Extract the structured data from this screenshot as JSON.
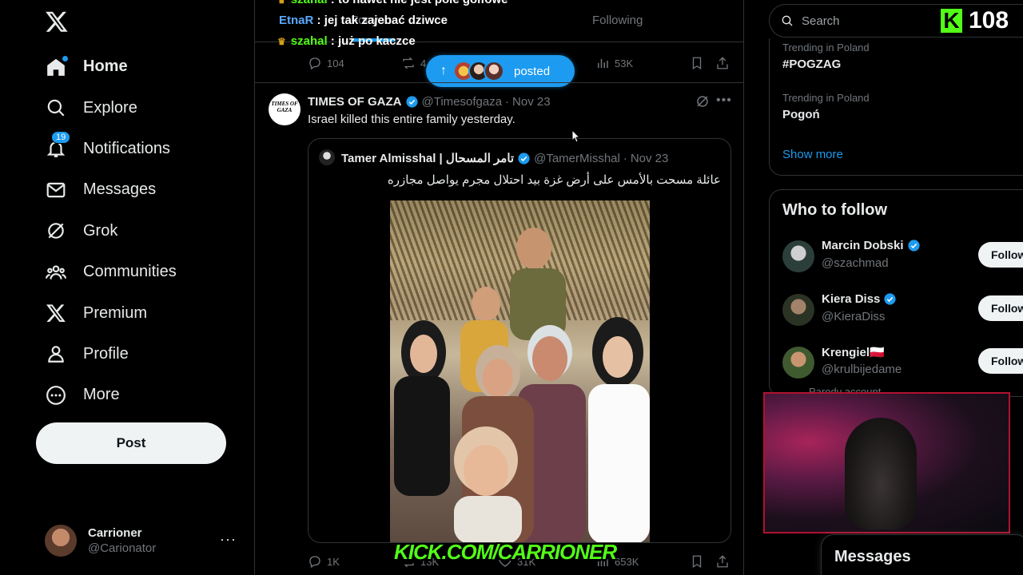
{
  "sidebar": {
    "logo": "X",
    "nav": [
      {
        "label": "Home"
      },
      {
        "label": "Explore"
      },
      {
        "label": "Notifications",
        "badge": "19"
      },
      {
        "label": "Messages"
      },
      {
        "label": "Grok"
      },
      {
        "label": "Communities"
      },
      {
        "label": "Premium"
      },
      {
        "label": "Profile"
      },
      {
        "label": "More"
      }
    ],
    "post_label": "Post",
    "account": {
      "name": "Carrioner",
      "handle": "@Carionator",
      "more": "···"
    }
  },
  "feed": {
    "tabs": {
      "for_you": "For you",
      "following": "Following"
    },
    "chat": [
      {
        "user": "szahal",
        "sep": " : ",
        "message": "to nawet nie jest pole golfowe"
      },
      {
        "user": "EtnaR",
        "sep": " : ",
        "message": "jej tak zajebać dziwce"
      },
      {
        "user": "szahal",
        "sep": " : ",
        "message": "już po kaczce"
      }
    ],
    "prev_actions": {
      "replies": "104",
      "reposts": "4",
      "views": "53K"
    },
    "posted_pill": {
      "arrow": "↑",
      "label": "posted"
    },
    "tweet": {
      "avatar_text": "TIMES OF GAZA",
      "name": "TIMES OF GAZA",
      "handle": "@Timesofgaza",
      "dot": "·",
      "date": "Nov 23",
      "text": "Israel killed this entire family yesterday.",
      "quote": {
        "name": "Tamer Almisshal | تامر المسحال",
        "handle": "@TamerMisshal",
        "dot": "·",
        "date": "Nov 23",
        "text": "عائلة مسحت بالأمس على أرض غزة بيد احتلال مجرم يواصل مجازره"
      },
      "actions": {
        "replies": "1K",
        "reposts": "13K",
        "likes": "31K",
        "views": "653K"
      }
    },
    "kick_banner": "KICK.COM/CARRIONER"
  },
  "right": {
    "search_placeholder": "Search",
    "kick_counter": {
      "logo": "K",
      "count": "108"
    },
    "trends": [
      {
        "category": "Trending in Poland",
        "name": "#POGZAG"
      },
      {
        "category": "Trending in Poland",
        "name": "Pogoń"
      }
    ],
    "show_more": "Show more",
    "who_to_follow": {
      "title": "Who to follow",
      "accounts": [
        {
          "name": "Marcin Dobski",
          "handle": "@szachmad",
          "follow": "Follow"
        },
        {
          "name": "Kiera Diss",
          "handle": "@KieraDiss",
          "follow": "Follow"
        },
        {
          "name": "Krengiel🇵🇱",
          "handle": "@krulbijedame",
          "follow": "Follow"
        }
      ],
      "parody_note": "Parody account"
    },
    "messages_title": "Messages"
  },
  "colors": {
    "accent": "#1d9bf0",
    "kick_green": "#53fc18",
    "border": "#2f3336",
    "muted": "#71767b"
  }
}
